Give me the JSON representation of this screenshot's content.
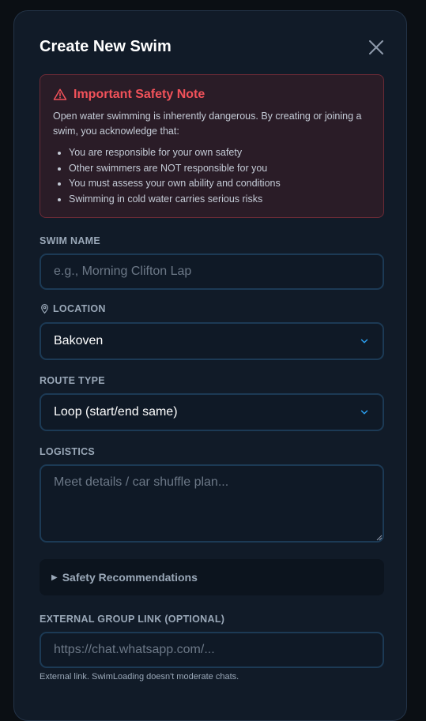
{
  "modal": {
    "title": "Create New Swim"
  },
  "safety_note": {
    "title": "Important Safety Note",
    "intro": "Open water swimming is inherently dangerous. By creating or joining a swim, you acknowledge that:",
    "items": [
      "You are responsible for your own safety",
      "Other swimmers are NOT responsible for you",
      "You must assess your own ability and conditions",
      "Swimming in cold water carries serious risks"
    ]
  },
  "form": {
    "swim_name": {
      "label": "SWIM NAME",
      "placeholder": "e.g., Morning Clifton Lap",
      "value": ""
    },
    "location": {
      "label": "LOCATION",
      "value": "Bakoven"
    },
    "route_type": {
      "label": "ROUTE TYPE",
      "value": "Loop (start/end same)"
    },
    "logistics": {
      "label": "LOGISTICS",
      "placeholder": "Meet details / car shuffle plan...",
      "value": ""
    },
    "safety_recommendations": {
      "label": "Safety Recommendations"
    },
    "external_link": {
      "label": "EXTERNAL GROUP LINK (OPTIONAL)",
      "placeholder": "https://chat.whatsapp.com/...",
      "value": "",
      "hint": "External link. SwimLoading doesn't moderate chats."
    }
  },
  "colors": {
    "accent": "#2b9ff0",
    "danger": "#f2525a",
    "background": "#111b28"
  },
  "icons": {
    "close": "close-icon",
    "warning": "warning-triangle-icon",
    "location": "map-pin-icon",
    "chevron": "chevron-down-icon"
  }
}
